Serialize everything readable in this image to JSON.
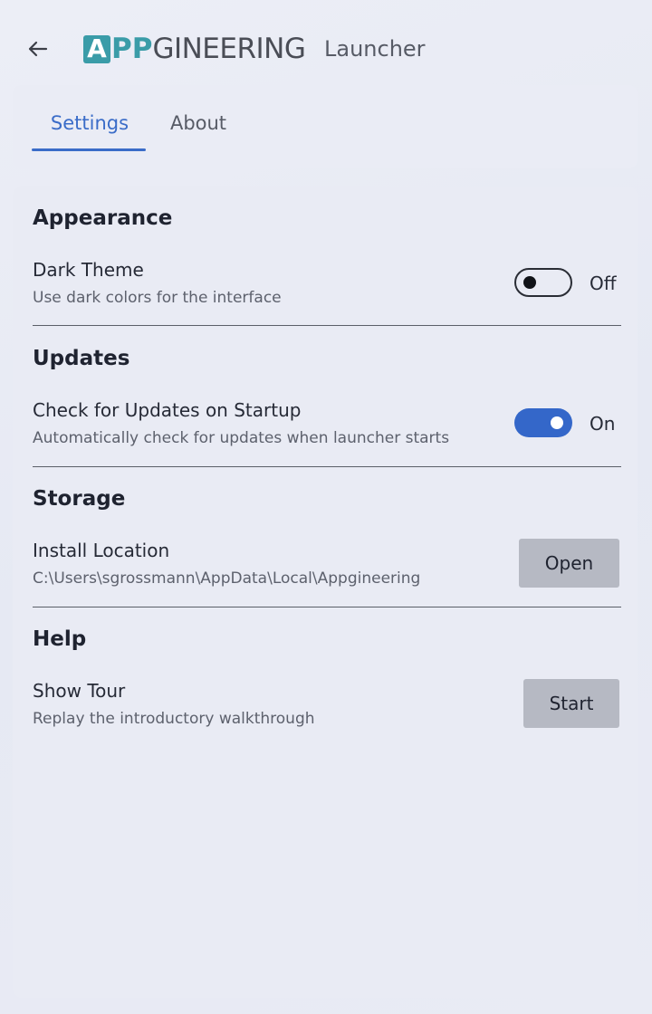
{
  "header": {
    "back_icon": "arrow-left-icon",
    "logo": {
      "a": "A",
      "pp": "PP",
      "rest": "GINEERING",
      "accent": "#3a9ca8"
    },
    "app_title": "Launcher"
  },
  "tabs": [
    {
      "label": "Settings",
      "active": true
    },
    {
      "label": "About",
      "active": false
    }
  ],
  "colors": {
    "accent": "#3a6cc8",
    "toggle_on": "#3467c9",
    "button_bg": "#b6b9c3"
  },
  "sections": {
    "appearance": {
      "title": "Appearance",
      "dark_theme": {
        "title": "Dark Theme",
        "description": "Use dark colors for the interface",
        "enabled": false,
        "state_label": "Off"
      }
    },
    "updates": {
      "title": "Updates",
      "check_updates": {
        "title": "Check for Updates on Startup",
        "description": "Automatically check for updates when launcher starts",
        "enabled": true,
        "state_label": "On"
      }
    },
    "storage": {
      "title": "Storage",
      "install_location": {
        "title": "Install Location",
        "description": "C:\\Users\\sgrossmann\\AppData\\Local\\Appgineering",
        "button_label": "Open"
      }
    },
    "help": {
      "title": "Help",
      "show_tour": {
        "title": "Show Tour",
        "description": "Replay the introductory walkthrough",
        "button_label": "Start"
      }
    }
  }
}
